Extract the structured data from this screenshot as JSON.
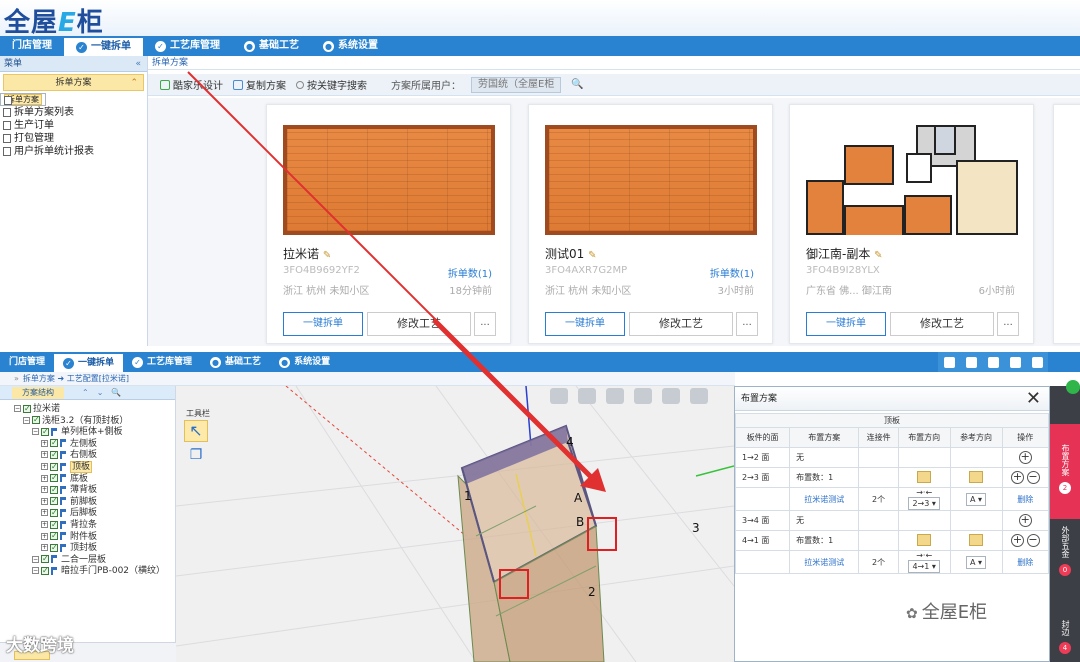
{
  "top": {
    "logo": {
      "main": "全屋",
      "e": "E",
      "tail": "柜"
    },
    "nav": [
      {
        "label": "门店管理",
        "icon": ""
      },
      {
        "label": "一键拆单",
        "icon": "✓",
        "active": true
      },
      {
        "label": "工艺库管理",
        "icon": "✓"
      },
      {
        "label": "基础工艺",
        "icon": "●"
      },
      {
        "label": "系统设置",
        "icon": "●"
      }
    ],
    "sidebar": {
      "header": "菜单",
      "collapse": "«",
      "group": "拆单方案",
      "group_collapse": "⌃",
      "items": [
        "拆单方案",
        "拆单方案列表",
        "生产订单",
        "打包管理",
        "用户拆单统计报表"
      ]
    },
    "breadcrumb": "拆单方案",
    "toolbar": {
      "kjl": "酷家乐设计",
      "copy": "复制方案",
      "search": "按关键字搜索",
      "user_label": "方案所属用户：",
      "user_value": "劳国统（全屋E柜",
      "search_icon": "🔍"
    },
    "cards": [
      {
        "name": "拉米诺",
        "code": "3FO4B9692YF2",
        "count": "拆单数(1)",
        "loc": "浙江 杭州 未知小区",
        "time": "18分钟前",
        "btn_split": "一键拆单",
        "btn_craft": "修改工艺",
        "btn_more": "...",
        "thumb": "wood"
      },
      {
        "name": "测试01",
        "code": "3FO4AXR7G2MP",
        "count": "拆单数(1)",
        "loc": "浙江 杭州 未知小区",
        "time": "3小时前",
        "btn_split": "一键拆单",
        "btn_craft": "修改工艺",
        "btn_more": "...",
        "thumb": "wood"
      },
      {
        "name": "御江南-副本",
        "code": "3FO4B9I28YLX",
        "count": "",
        "loc": "广东省 佛... 御江南",
        "time": "6小时前",
        "btn_split": "一键拆单",
        "btn_craft": "修改工艺",
        "btn_more": "...",
        "thumb": "floorplan"
      }
    ],
    "pen": "✎"
  },
  "bottom": {
    "nav": [
      {
        "label": "门店管理",
        "icon": ""
      },
      {
        "label": "一键拆单",
        "icon": "✓",
        "active": true
      },
      {
        "label": "工艺库管理",
        "icon": "✓"
      },
      {
        "label": "基础工艺",
        "icon": "●"
      },
      {
        "label": "系统设置",
        "icon": "●"
      }
    ],
    "breadcrumb": "拆单方案 ➜ 工艺配置[拉米诺]",
    "breadcrumb_chevron": "»",
    "tree_tab": "方案结构",
    "tree_actions": "⌃⌄🔍",
    "tree": [
      {
        "label": "拉米诺",
        "depth": 0
      },
      {
        "label": "浅柜3.2（有顶封板）",
        "depth": 1
      },
      {
        "label": "单列柜体+側板",
        "depth": 2
      },
      {
        "label": "左侧板",
        "depth": 3
      },
      {
        "label": "右侧板",
        "depth": 3
      },
      {
        "label": "顶板",
        "depth": 3,
        "hl": true
      },
      {
        "label": "底板",
        "depth": 3
      },
      {
        "label": "薄背板",
        "depth": 3
      },
      {
        "label": "前脚板",
        "depth": 3
      },
      {
        "label": "后脚板",
        "depth": 3
      },
      {
        "label": "背拉条",
        "depth": 3
      },
      {
        "label": "附件板",
        "depth": 3
      },
      {
        "label": "顶封板",
        "depth": 3
      },
      {
        "label": "二合一层板",
        "depth": 2
      },
      {
        "label": "暗拉手门PB-002（横纹）",
        "depth": 2
      }
    ],
    "watermark_left": "大数跨境",
    "toolbox_label": "工具栏",
    "viewport_labels": [
      "1",
      "2",
      "3",
      "4",
      "A",
      "B"
    ],
    "panel": {
      "title": "布置方案",
      "close": "✕",
      "board": "顶板",
      "headers": [
        "板件的面",
        "布置方案",
        "连接件",
        "布置方向",
        "参考方向",
        "操作"
      ],
      "rows": [
        {
          "face": "1→2 面",
          "plan": "无"
        },
        {
          "face": "2→3 面",
          "plan": "布置数：1"
        },
        {
          "face": "",
          "plan": "拉米诺测试",
          "conn": "2个",
          "dir": "2→3",
          "ref": "A",
          "op": "删除"
        },
        {
          "face": "3→4 面",
          "plan": "无"
        },
        {
          "face": "4→1 面",
          "plan": "布置数：1"
        },
        {
          "face": "",
          "plan": "拉米诺测试",
          "conn": "2个",
          "dir": "4→1",
          "ref": "A",
          "op": "删除"
        }
      ]
    },
    "watermark_right": "全屋E柜",
    "side_tabs": [
      {
        "label": "布置方案",
        "num": "2"
      },
      {
        "label": "外部五金",
        "num": "0"
      },
      {
        "label": "封边",
        "num": "4"
      }
    ]
  }
}
